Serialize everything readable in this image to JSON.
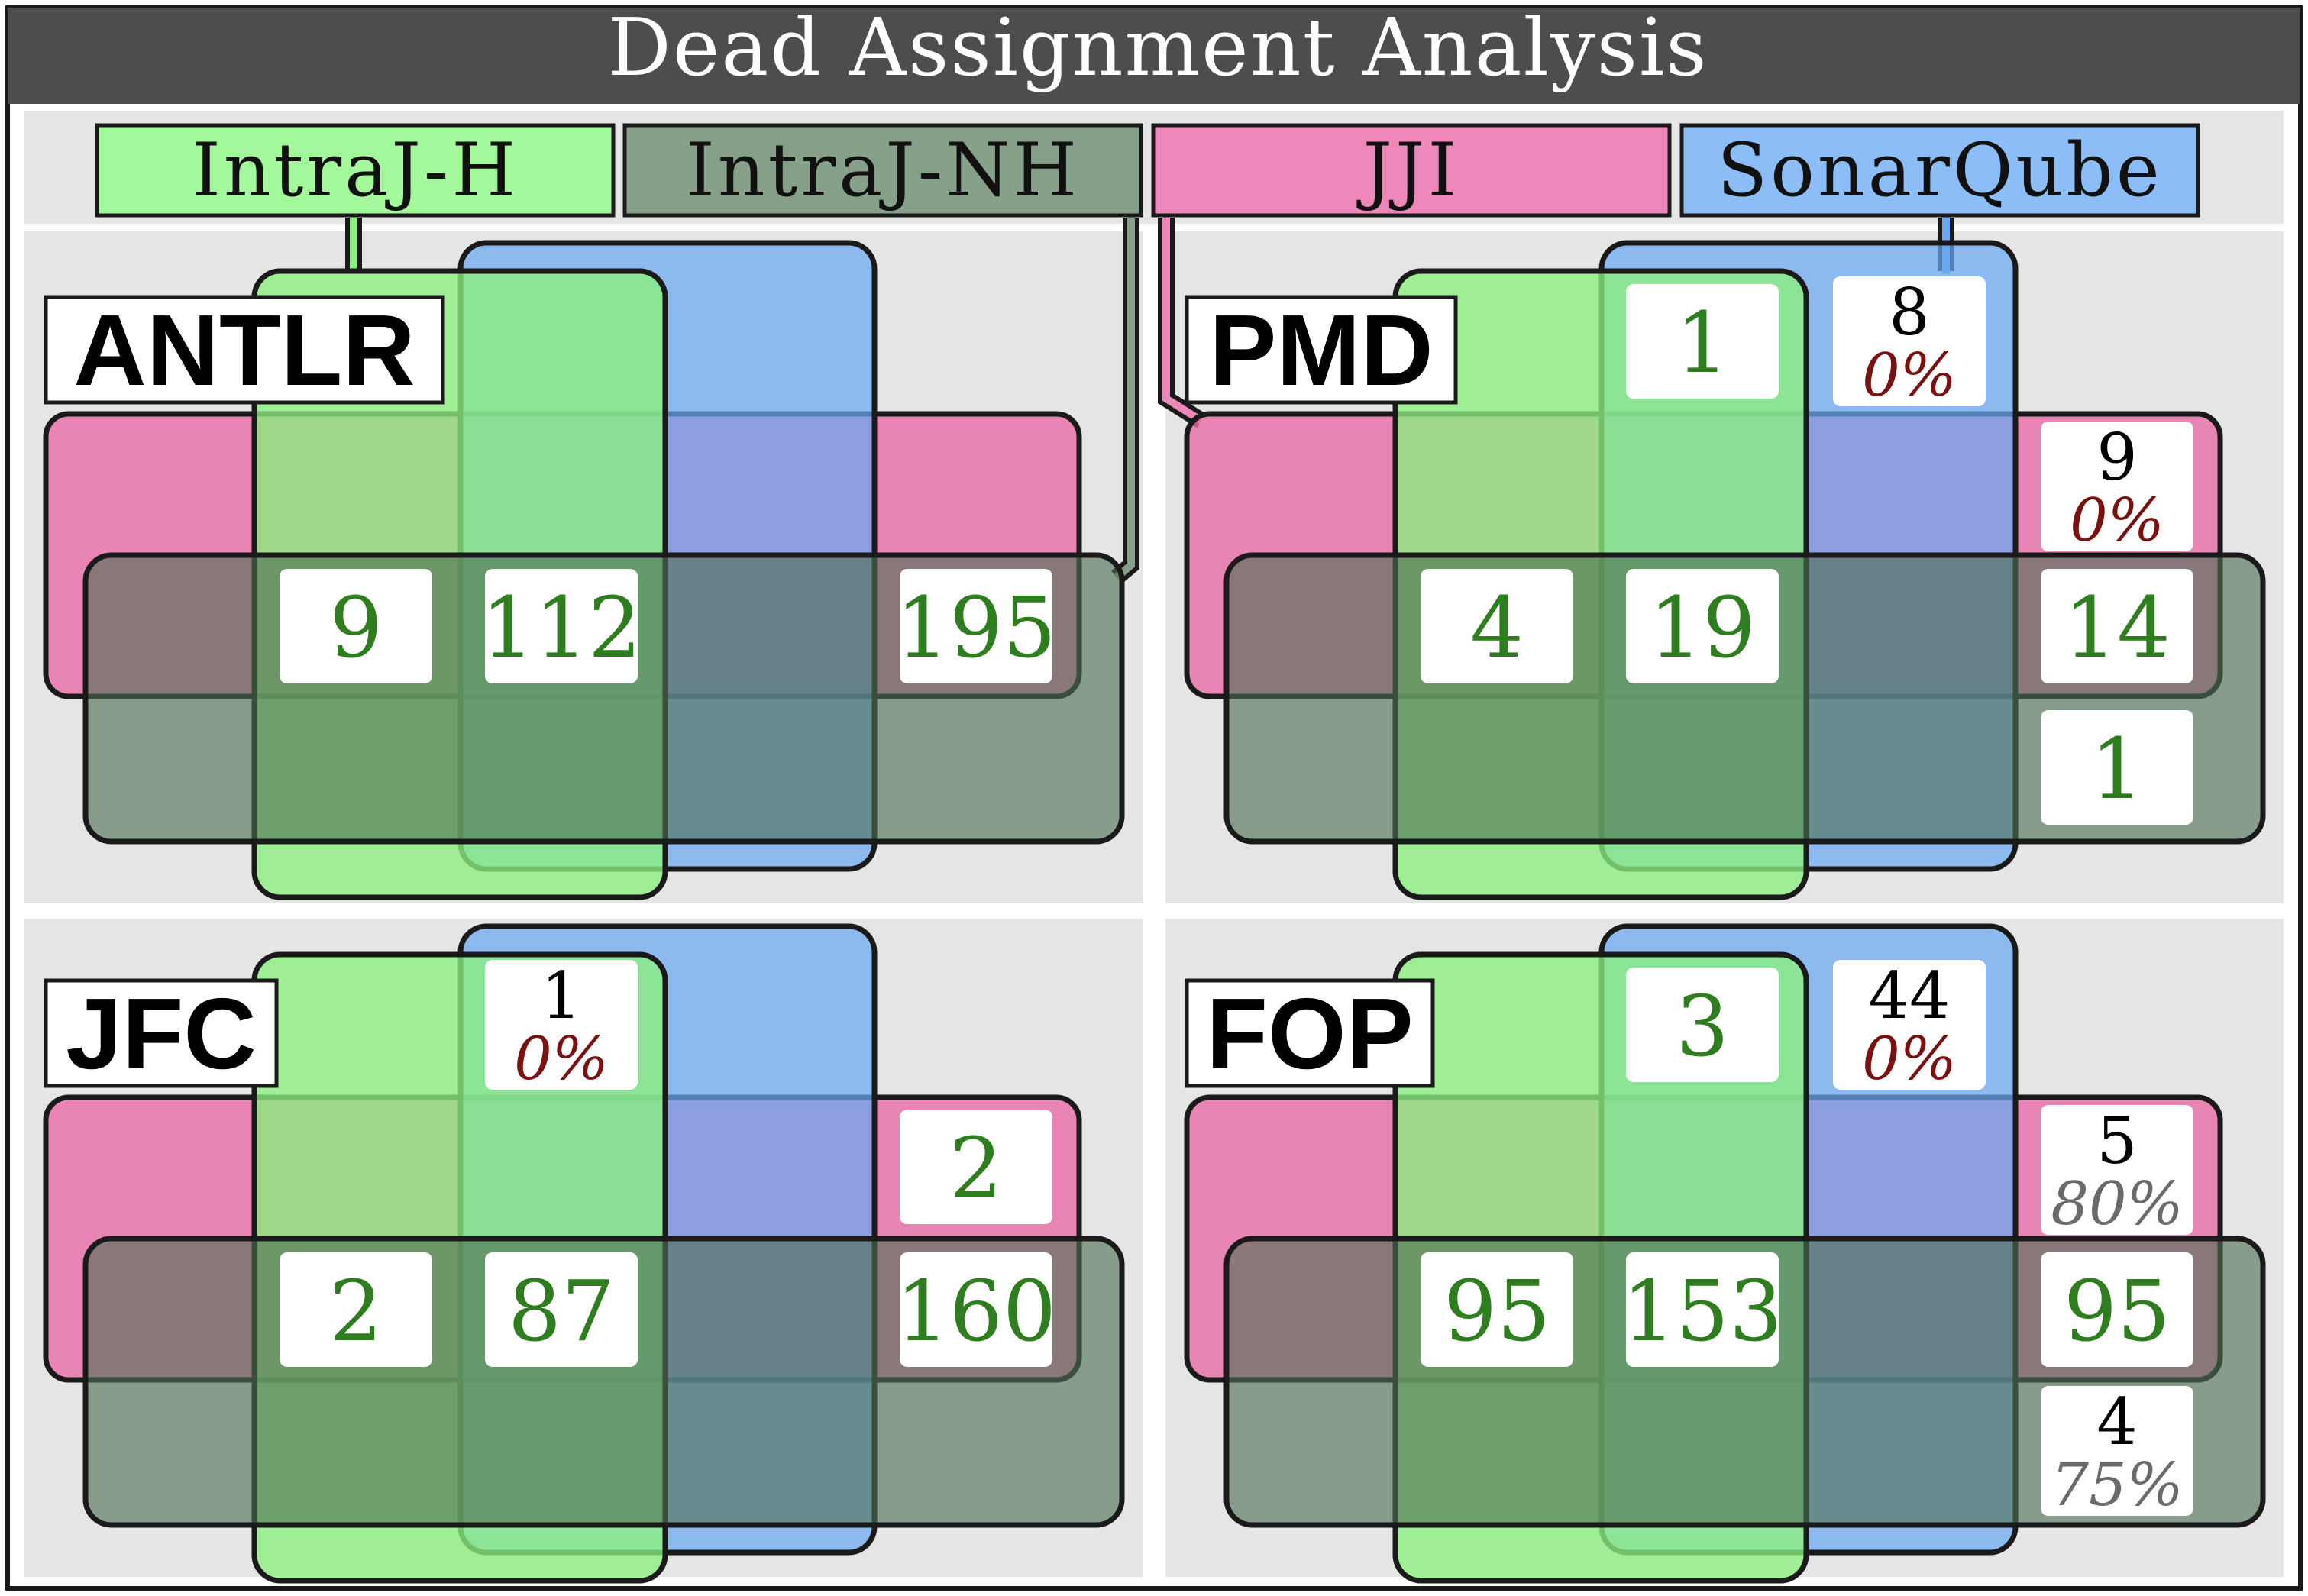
{
  "title": "Dead Assignment Analysis",
  "tools": [
    {
      "key": "intraj_h",
      "label": "IntraJ-H",
      "color": "#8cf07e"
    },
    {
      "key": "intraj_nh",
      "label": "IntraJ-NH",
      "color": "#5e7d61"
    },
    {
      "key": "jji",
      "label": "JJI",
      "color": "#ea6aa8"
    },
    {
      "key": "sonarqube",
      "label": "SonarQube",
      "color": "#6aa9f2"
    }
  ],
  "panels": [
    {
      "name": "ANTLR",
      "counts": [
        {
          "region": "IntraJ-H ∩ IntraJ-NH ∩ JJI only",
          "value": "9"
        },
        {
          "region": "IntraJ-H ∩ IntraJ-NH ∩ JJI ∩ SonarQube",
          "value": "112"
        },
        {
          "region": "IntraJ-NH ∩ JJI only",
          "value": "195"
        }
      ]
    },
    {
      "name": "PMD",
      "counts": [
        {
          "region": "IntraJ-H ∩ SonarQube only",
          "value": "1"
        },
        {
          "region": "SonarQube only",
          "value": "8",
          "percent": "0%"
        },
        {
          "region": "JJI only",
          "value": "9",
          "percent": "0%"
        },
        {
          "region": "IntraJ-H ∩ IntraJ-NH ∩ JJI only",
          "value": "4"
        },
        {
          "region": "IntraJ-H ∩ IntraJ-NH ∩ JJI ∩ SonarQube",
          "value": "19"
        },
        {
          "region": "IntraJ-NH ∩ JJI only",
          "value": "14"
        },
        {
          "region": "IntraJ-NH only",
          "value": "1"
        }
      ]
    },
    {
      "name": "JFC",
      "counts": [
        {
          "region": "IntraJ-H ∩ SonarQube only",
          "value": "1",
          "percent": "0%"
        },
        {
          "region": "JJI only",
          "value": "2"
        },
        {
          "region": "IntraJ-H ∩ IntraJ-NH ∩ JJI only",
          "value": "2"
        },
        {
          "region": "IntraJ-H ∩ IntraJ-NH ∩ JJI ∩ SonarQube",
          "value": "87"
        },
        {
          "region": "IntraJ-NH ∩ JJI only",
          "value": "160"
        }
      ]
    },
    {
      "name": "FOP",
      "counts": [
        {
          "region": "IntraJ-H ∩ SonarQube only",
          "value": "3"
        },
        {
          "region": "SonarQube only",
          "value": "44",
          "percent": "0%"
        },
        {
          "region": "JJI only",
          "value": "5",
          "percent": "80%"
        },
        {
          "region": "IntraJ-H ∩ IntraJ-NH ∩ JJI only",
          "value": "95"
        },
        {
          "region": "IntraJ-H ∩ IntraJ-NH ∩ JJI ∩ SonarQube",
          "value": "153"
        },
        {
          "region": "IntraJ-NH ∩ JJI only",
          "value": "95"
        },
        {
          "region": "IntraJ-NH only",
          "value": "4",
          "percent": "75%"
        }
      ]
    }
  ]
}
